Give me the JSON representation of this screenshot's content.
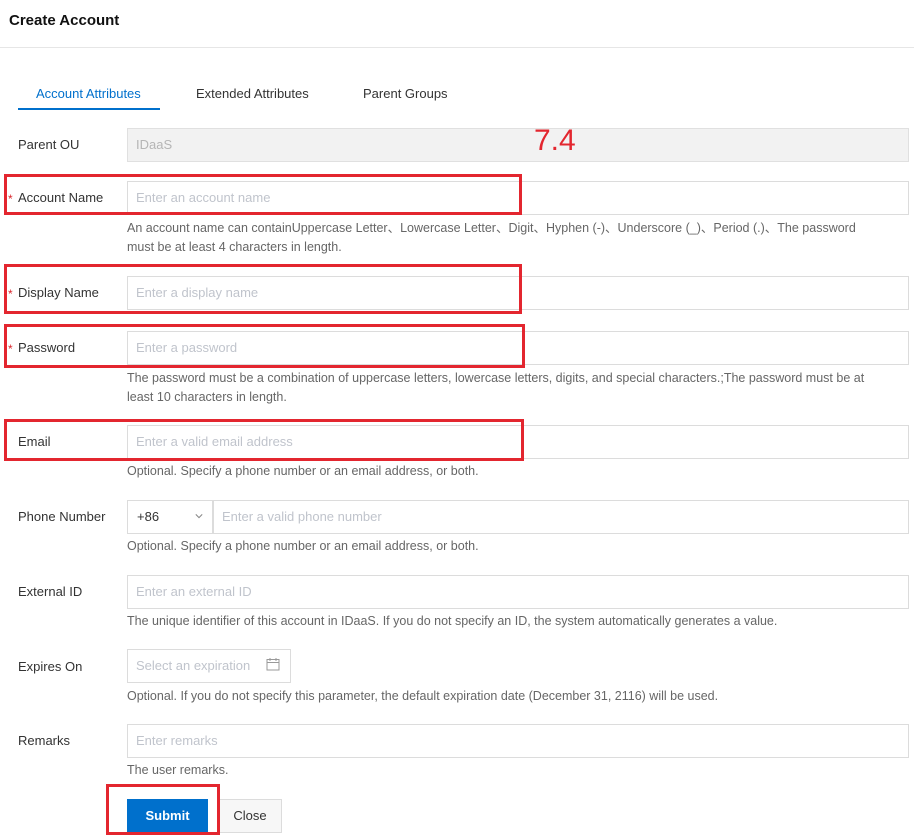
{
  "header": {
    "title": "Create Account"
  },
  "tabs": [
    {
      "label": "Account Attributes",
      "active": true
    },
    {
      "label": "Extended Attributes",
      "active": false
    },
    {
      "label": "Parent Groups",
      "active": false
    }
  ],
  "annotation_label": "7.4",
  "form": {
    "parent_ou": {
      "label": "Parent OU",
      "value": "IDaaS"
    },
    "account_name": {
      "label": "Account Name",
      "placeholder": "Enter an account name",
      "help_line1": "An account name can containUppercase Letter、Lowercase Letter、Digit、Hyphen (-)、Underscore (_)、Period (.)、The password",
      "help_line2": "must be at least 4 characters in length."
    },
    "display_name": {
      "label": "Display Name",
      "placeholder": "Enter a display name"
    },
    "password": {
      "label": "Password",
      "placeholder": "Enter a password",
      "help_line1": "The password must be a combination of uppercase letters, lowercase letters, digits, and special characters.;The password must be at",
      "help_line2": "least 10 characters in length."
    },
    "email": {
      "label": "Email",
      "placeholder": "Enter a valid email address",
      "help": "Optional. Specify a phone number or an email address, or both."
    },
    "phone": {
      "label": "Phone Number",
      "country_code": "+86",
      "placeholder": "Enter a valid phone number",
      "help": "Optional. Specify a phone number or an email address, or both."
    },
    "external_id": {
      "label": "External ID",
      "placeholder": "Enter an external ID",
      "help": "The unique identifier of this account in IDaaS. If you do not specify an ID, the system automatically generates a value."
    },
    "expires_on": {
      "label": "Expires On",
      "placeholder": "Select an expiration",
      "help": "Optional. If you do not specify this parameter, the default expiration date (December 31, 2116) will be used."
    },
    "remarks": {
      "label": "Remarks",
      "placeholder": "Enter remarks",
      "help": "The user remarks."
    },
    "required_mark": "*"
  },
  "actions": {
    "submit": "Submit",
    "close": "Close"
  },
  "colors": {
    "accent": "#0070cc",
    "annotation": "#e3262f",
    "required": "#d9262b"
  }
}
